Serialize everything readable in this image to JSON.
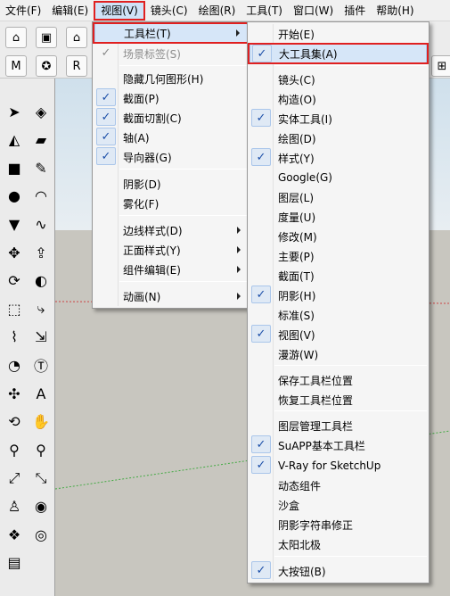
{
  "menubar": {
    "items": [
      {
        "label": "文件(F)"
      },
      {
        "label": "编辑(E)"
      },
      {
        "label": "视图(V)"
      },
      {
        "label": "镜头(C)"
      },
      {
        "label": "绘图(R)"
      },
      {
        "label": "工具(T)"
      },
      {
        "label": "窗口(W)"
      },
      {
        "label": "插件"
      },
      {
        "label": "帮助(H)"
      }
    ]
  },
  "view_menu": {
    "items": [
      {
        "label": "工具栏(T)",
        "submenu": true,
        "highlighted": true
      },
      {
        "label": "场景标签(S)",
        "checked": true,
        "disabled": true
      },
      {
        "label": "隐藏几何图形(H)"
      },
      {
        "label": "截面(P)",
        "checked": true
      },
      {
        "label": "截面切割(C)",
        "checked": true
      },
      {
        "label": "轴(A)",
        "checked": true
      },
      {
        "label": "导向器(G)",
        "checked": true
      },
      {
        "label": "阴影(D)"
      },
      {
        "label": "雾化(F)"
      },
      {
        "label": "边线样式(D)",
        "submenu": true
      },
      {
        "label": "正面样式(Y)",
        "submenu": true
      },
      {
        "label": "组件编辑(E)",
        "submenu": true
      },
      {
        "label": "动画(N)",
        "submenu": true
      }
    ]
  },
  "toolbar_menu": {
    "items": [
      {
        "label": "开始(E)"
      },
      {
        "label": "大工具集(A)",
        "checked": true,
        "highlighted": true
      },
      {
        "label": "镜头(C)"
      },
      {
        "label": "构造(O)"
      },
      {
        "label": "实体工具(I)",
        "checked": true
      },
      {
        "label": "绘图(D)"
      },
      {
        "label": "样式(Y)",
        "checked": true
      },
      {
        "label": "Google(G)"
      },
      {
        "label": "图层(L)"
      },
      {
        "label": "度量(U)"
      },
      {
        "label": "修改(M)"
      },
      {
        "label": "主要(P)"
      },
      {
        "label": "截面(T)"
      },
      {
        "label": "阴影(H)",
        "checked": true
      },
      {
        "label": "标准(S)"
      },
      {
        "label": "视图(V)",
        "checked": true
      },
      {
        "label": "漫游(W)"
      },
      {
        "label": "保存工具栏位置"
      },
      {
        "label": "恢复工具栏位置"
      },
      {
        "label": "图层管理工具栏"
      },
      {
        "label": "SuAPP基本工具栏",
        "checked": true
      },
      {
        "label": "V-Ray for SketchUp",
        "checked": true
      },
      {
        "label": "动态组件"
      },
      {
        "label": "沙盒"
      },
      {
        "label": "阴影字符串修正"
      },
      {
        "label": "太阳北极"
      },
      {
        "label": "大按钮(B)",
        "checked": true
      }
    ]
  },
  "toolbar_icons": {
    "row1": [
      {
        "icon": "house-icon",
        "glyph": "⌂"
      },
      {
        "icon": "box-view-icon",
        "glyph": "▣"
      },
      {
        "icon": "home-icon",
        "glyph": "⌂"
      }
    ],
    "row2": [
      {
        "icon": "m-button-icon",
        "glyph": "M"
      },
      {
        "icon": "gear-plugin-icon",
        "glyph": "✪"
      },
      {
        "icon": "r-button-icon",
        "glyph": "R"
      }
    ]
  },
  "palette_icons": [
    {
      "icon": "select-arrow-icon",
      "glyph": "➤"
    },
    {
      "icon": "make-component-icon",
      "glyph": "◈"
    },
    {
      "icon": "paint-bucket-icon",
      "glyph": "◭"
    },
    {
      "icon": "eraser-icon",
      "glyph": "▰"
    },
    {
      "icon": "rectangle-icon",
      "glyph": "■"
    },
    {
      "icon": "pencil-line-icon",
      "glyph": "✎"
    },
    {
      "icon": "circle-icon",
      "glyph": "●"
    },
    {
      "icon": "arc-icon",
      "glyph": "◠"
    },
    {
      "icon": "polygon-icon",
      "glyph": "▼"
    },
    {
      "icon": "freehand-icon",
      "glyph": "∿"
    },
    {
      "icon": "move-icon",
      "glyph": "✥"
    },
    {
      "icon": "push-pull-icon",
      "glyph": "⇪"
    },
    {
      "icon": "rotate-icon",
      "glyph": "⟳"
    },
    {
      "icon": "follow-me-icon",
      "glyph": "◐"
    },
    {
      "icon": "scale-icon",
      "glyph": "⬚"
    },
    {
      "icon": "offset-icon",
      "glyph": "⤷"
    },
    {
      "icon": "tape-measure-icon",
      "glyph": "⌇"
    },
    {
      "icon": "dimension-icon",
      "glyph": "⇲"
    },
    {
      "icon": "protractor-icon",
      "glyph": "◔"
    },
    {
      "icon": "text-icon",
      "glyph": "Ⓣ"
    },
    {
      "icon": "axes-icon",
      "glyph": "✣"
    },
    {
      "icon": "3d-text-icon",
      "glyph": "A"
    },
    {
      "icon": "orbit-icon",
      "glyph": "⟲"
    },
    {
      "icon": "pan-icon",
      "glyph": "✋"
    },
    {
      "icon": "zoom-icon",
      "glyph": "⚲"
    },
    {
      "icon": "zoom-window-icon",
      "glyph": "⚲"
    },
    {
      "icon": "zoom-extents-icon",
      "glyph": "⤢"
    },
    {
      "icon": "previous-view-icon",
      "glyph": "⤡"
    },
    {
      "icon": "position-camera-icon",
      "glyph": "♙"
    },
    {
      "icon": "look-around-icon",
      "glyph": "◉"
    },
    {
      "icon": "walk-icon",
      "glyph": "❖"
    },
    {
      "icon": "section-plane-icon",
      "glyph": "◎"
    },
    {
      "icon": "layers-icon",
      "glyph": "▤"
    }
  ],
  "colors": {
    "highlight_border": "#e02020",
    "check_color": "#1c4fa8",
    "menu_bg": "#f5f5f5",
    "axis_red": "#cc4444",
    "axis_green": "#44aa44"
  }
}
